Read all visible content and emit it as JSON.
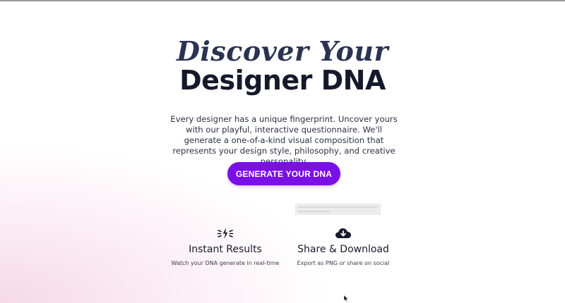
{
  "hero": {
    "title_script": "Discover Your",
    "title_main": "Designer DNA",
    "description": "Every designer has a unique fingerprint. Uncover yours with our playful, interactive questionnaire. We'll generate a one-of-a-kind visual composition that represents your design style, philosophy, and creative personality.",
    "cta_label": "GENERATE YOUR DNA"
  },
  "features": [
    {
      "icon": "lightning-icon",
      "title": "Instant Results",
      "subtitle": "Watch your DNA generate in real-time"
    },
    {
      "icon": "cloud-download-icon",
      "title": "Share & Download",
      "subtitle": "Export as PNG or share on social"
    }
  ],
  "colors": {
    "accent": "#7a10e6",
    "heading": "#151a2b",
    "background_tint": "#f6d9e7"
  }
}
